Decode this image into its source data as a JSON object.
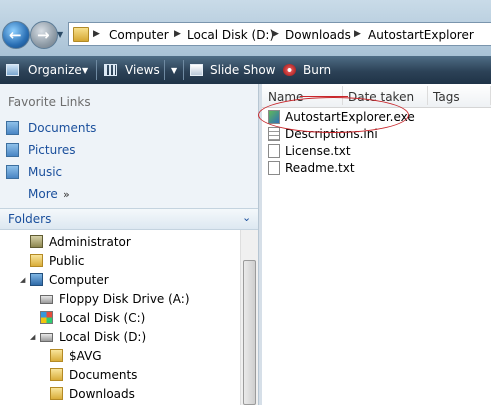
{
  "address": {
    "crumbs": [
      "Computer",
      "Local Disk (D:)",
      "Downloads",
      "AutostartExplorer"
    ]
  },
  "toolbar": {
    "organize": "Organize",
    "views": "Views",
    "slideshow": "Slide Show",
    "burn": "Burn"
  },
  "nav": {
    "favorites_title": "Favorite Links",
    "favorites": [
      "Documents",
      "Pictures",
      "Music"
    ],
    "more": "More",
    "folders_title": "Folders",
    "tree": [
      "Administrator",
      "Public",
      "Computer",
      "Floppy Disk Drive (A:)",
      "Local Disk (C:)",
      "Local Disk (D:)",
      "$AVG",
      "Documents",
      "Downloads"
    ]
  },
  "files": {
    "columns": [
      "Name",
      "Date taken",
      "Tags"
    ],
    "items": [
      "AutostartExplorer.exe",
      "Descriptions.ini",
      "License.txt",
      "Readme.txt"
    ]
  },
  "colors": {
    "accent": "#1a4f9c",
    "annotation": "#c8262b"
  }
}
